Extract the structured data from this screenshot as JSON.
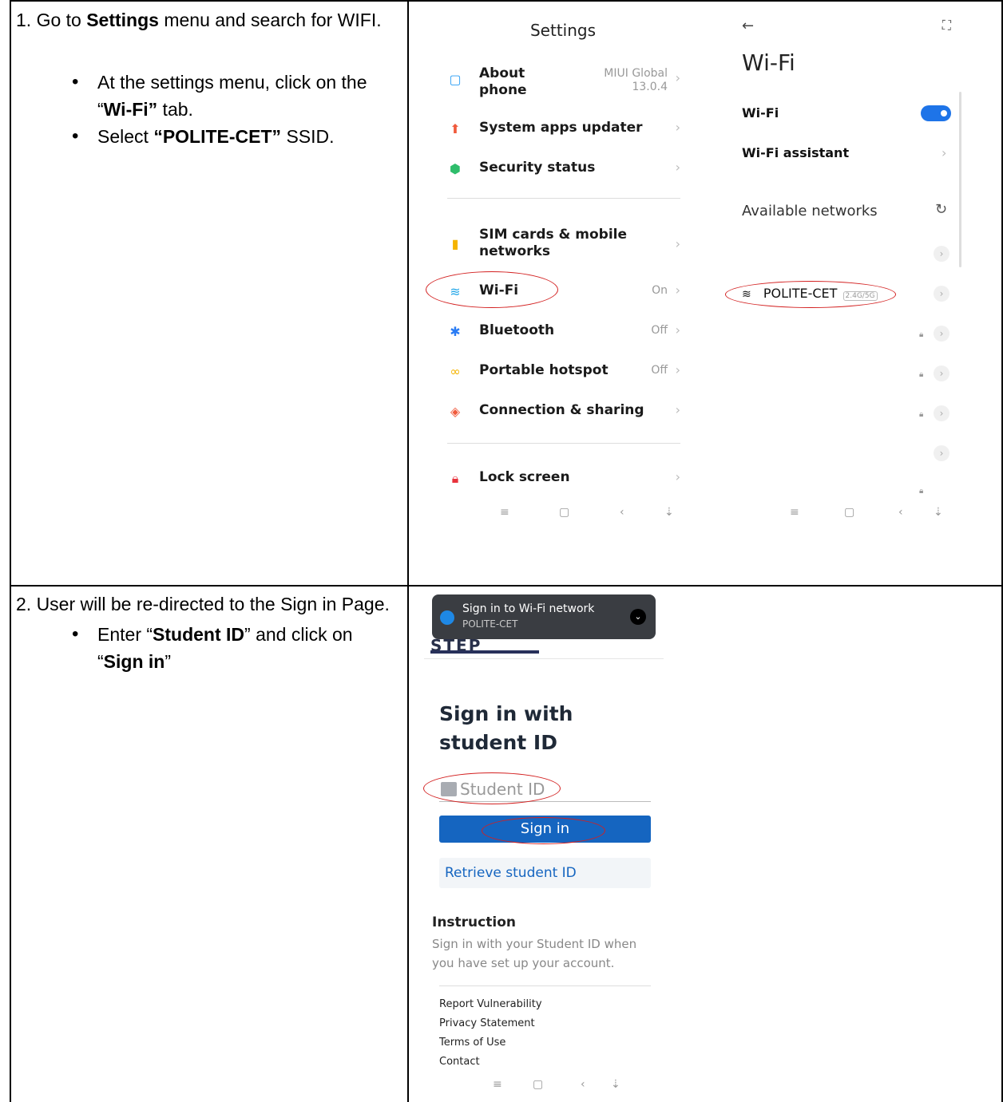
{
  "step1": {
    "intro_prefix": "1. Go to ",
    "intro_bold": "Settings",
    "intro_suffix": " menu and search for WIFI.",
    "bullet1_prefix": "At the settings menu, click on the “",
    "bullet1_bold": "Wi-Fi”",
    "bullet1_suffix": " tab.",
    "bullet2_prefix": "Select ",
    "bullet2_bold": "“POLITE-CET”",
    "bullet2_suffix": " SSID."
  },
  "step2": {
    "intro": "2. User will be re-directed to the Sign in Page.",
    "bullet_prefix": "Enter “",
    "bullet_bold": "Student ID",
    "bullet_mid": "” and click on “",
    "bullet_bold2": "Sign in",
    "bullet_suffix": "”"
  },
  "settings_screen": {
    "title": "Settings",
    "items": [
      {
        "label": "About phone",
        "value": "MIUI Global 13.0.4",
        "icon": "phone-icon",
        "color": "#2a9df4"
      },
      {
        "label": "System apps updater",
        "value": "",
        "icon": "arrow-up-icon",
        "color": "#f05a3c"
      },
      {
        "label": "Security status",
        "value": "",
        "icon": "shield-icon",
        "color": "#2ebd6b"
      },
      {
        "label": "SIM cards & mobile networks",
        "value": "",
        "icon": "sim-icon",
        "color": "#f5b400"
      },
      {
        "label": "Wi-Fi",
        "value": "On",
        "icon": "wifi-icon",
        "color": "#22a6e8"
      },
      {
        "label": "Bluetooth",
        "value": "Off",
        "icon": "bluetooth-icon",
        "color": "#2a7cf4"
      },
      {
        "label": "Portable hotspot",
        "value": "Off",
        "icon": "hotspot-icon",
        "color": "#f5b400"
      },
      {
        "label": "Connection & sharing",
        "value": "",
        "icon": "share-icon",
        "color": "#f05a3c"
      },
      {
        "label": "Lock screen",
        "value": "",
        "icon": "lock-icon",
        "color": "#e8323c"
      }
    ]
  },
  "wifi_screen": {
    "title": "Wi-Fi",
    "wifi_label": "Wi-Fi",
    "assistant_label": "Wi-Fi assistant",
    "available_label": "Available networks",
    "network_name": "POLITE-CET",
    "network_badge": "2.4G/5G"
  },
  "signin_screen": {
    "banner_title": "Sign in to Wi-Fi network",
    "banner_sub": "POLITE-CET",
    "logo_text": "STEP",
    "title": "Sign in with student ID",
    "input_placeholder": "Student ID",
    "sign_in_button": "Sign in",
    "retrieve_button": "Retrieve student ID",
    "instruction_heading": "Instruction",
    "instruction_text": "Sign in with your Student ID when you have set up your account.",
    "links": [
      "Report Vulnerability",
      "Privacy Statement",
      "Terms of Use",
      "Contact"
    ]
  },
  "colors": {
    "annotation": "#d32020",
    "toggle": "#1e74e8",
    "primary_button": "#1565c0"
  }
}
